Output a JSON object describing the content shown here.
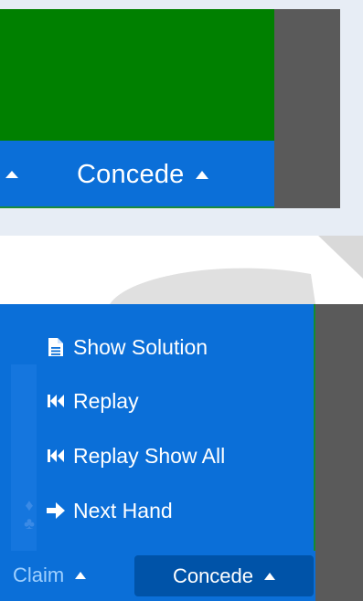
{
  "top": {
    "concede_label": "Concede"
  },
  "menu": {
    "items": [
      {
        "label": "Show Solution",
        "icon": "document-icon"
      },
      {
        "label": "Replay",
        "icon": "rewind-icon"
      },
      {
        "label": "Replay Show All",
        "icon": "rewind-icon"
      },
      {
        "label": "Next Hand",
        "icon": "arrow-right-icon"
      }
    ]
  },
  "bottom_bar": {
    "claim_label": "Claim",
    "concede_label": "Concede"
  },
  "colors": {
    "bar_blue": "#0b6fd8",
    "active_blue": "#0053a8",
    "table_green": "#008000",
    "side_gray": "#5a5a5a"
  }
}
